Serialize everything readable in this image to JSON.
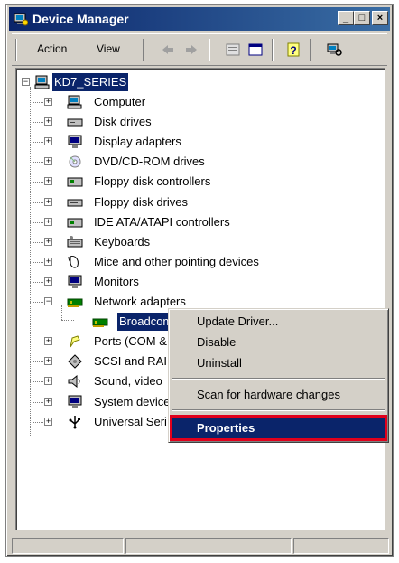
{
  "window": {
    "title": "Device Manager"
  },
  "titlebar_buttons": {
    "minimize": "_",
    "maximize": "□",
    "close": "×"
  },
  "menu": {
    "action": "Action",
    "view": "View"
  },
  "toolbar": [
    "back-arrow-icon",
    "forward-arrow-icon",
    "properties-sheet-icon",
    "columns-icon",
    "help-icon",
    "scan-hardware-icon"
  ],
  "tree": {
    "root": "KD7_SERIES",
    "items": [
      {
        "label": "Computer",
        "icon": "computer-icon"
      },
      {
        "label": "Disk drives",
        "icon": "disk-drive-icon"
      },
      {
        "label": "Display adapters",
        "icon": "monitor-icon"
      },
      {
        "label": "DVD/CD-ROM drives",
        "icon": "cdrom-icon"
      },
      {
        "label": "Floppy disk controllers",
        "icon": "controller-icon"
      },
      {
        "label": "Floppy disk drives",
        "icon": "floppy-icon"
      },
      {
        "label": "IDE ATA/ATAPI controllers",
        "icon": "controller-icon"
      },
      {
        "label": "Keyboards",
        "icon": "keyboard-icon"
      },
      {
        "label": "Mice and other pointing devices",
        "icon": "mouse-icon"
      },
      {
        "label": "Monitors",
        "icon": "monitor-icon"
      },
      {
        "label": "Network adapters",
        "icon": "network-card-icon"
      },
      {
        "label": "Broadcom",
        "icon": "network-card-icon"
      },
      {
        "label": "Ports (COM &",
        "icon": "port-icon"
      },
      {
        "label": "SCSI and RAI",
        "icon": "scsi-icon"
      },
      {
        "label": "Sound, video",
        "icon": "speaker-icon"
      },
      {
        "label": "System device",
        "icon": "system-icon"
      },
      {
        "label": "Universal Seri",
        "icon": "usb-icon"
      }
    ]
  },
  "context_menu": {
    "items": [
      "Update Driver...",
      "Disable",
      "Uninstall",
      "Scan for hardware changes",
      "Properties"
    ]
  },
  "colors": {
    "titlebar": "#0a246a",
    "selection": "#0a246a",
    "highlight_box": "#e0001c",
    "chrome": "#d4d0c8"
  }
}
